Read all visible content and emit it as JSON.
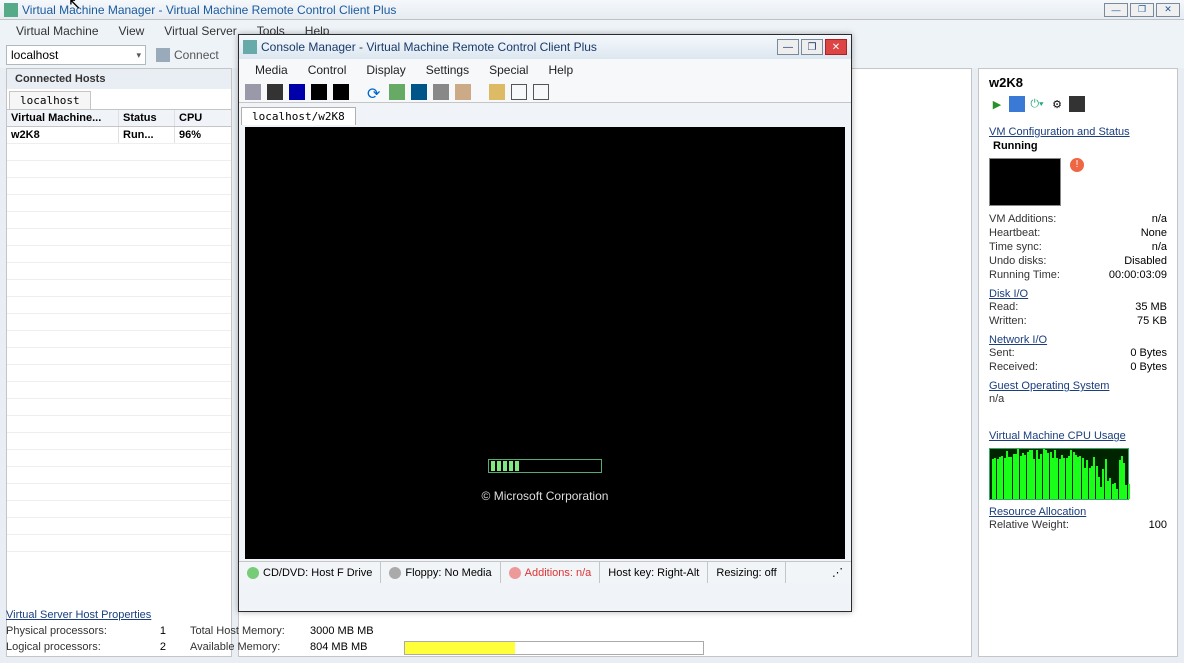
{
  "main": {
    "title": "Virtual Machine Manager - Virtual Machine Remote Control Client Plus",
    "menu": [
      "Virtual Machine",
      "View",
      "Virtual Server",
      "Tools",
      "Help"
    ],
    "host_selected": "localhost",
    "connect_label": "Connect"
  },
  "left": {
    "header": "Connected Hosts",
    "tab": "localhost",
    "columns": [
      "Virtual Machine...",
      "Status",
      "CPU"
    ],
    "rows": [
      {
        "name": "w2K8",
        "status": "Run...",
        "cpu": "96%"
      }
    ]
  },
  "bottom": {
    "heading": "Virtual Server Host Properties",
    "physical_k": "Physical processors:",
    "physical_v": "1",
    "logical_k": "Logical processors:",
    "logical_v": "2",
    "total_mem_k": "Total Host Memory:",
    "total_mem_v": "3000 MB MB",
    "avail_mem_k": "Available Memory:",
    "avail_mem_v": "804 MB MB",
    "mem_pct": 37
  },
  "console": {
    "title": "Console Manager - Virtual Machine Remote Control Client Plus",
    "menu": [
      "Media",
      "Control",
      "Display",
      "Settings",
      "Special",
      "Help"
    ],
    "tab": "localhost/w2K8",
    "boot_text": "© Microsoft Corporation",
    "status": {
      "cd": "CD/DVD: Host F Drive",
      "floppy": "Floppy: No Media",
      "additions": "Additions: n/a",
      "hostkey": "Host key: Right-Alt",
      "resizing": "Resizing: off"
    }
  },
  "right": {
    "vm_name": "w2K8",
    "sect_config": "VM Configuration and Status",
    "status": "Running",
    "props": [
      {
        "k": "VM Additions:",
        "v": "n/a"
      },
      {
        "k": "Heartbeat:",
        "v": "None"
      },
      {
        "k": "Time sync:",
        "v": "n/a"
      },
      {
        "k": "Undo disks:",
        "v": "Disabled"
      },
      {
        "k": "Running Time:",
        "v": "00:00:03:09"
      }
    ],
    "sect_diskio": "Disk I/O",
    "diskio": [
      {
        "k": "Read:",
        "v": "35 MB"
      },
      {
        "k": "Written:",
        "v": "75 KB"
      }
    ],
    "sect_netio": "Network I/O",
    "netio": [
      {
        "k": "Sent:",
        "v": "0 Bytes"
      },
      {
        "k": "Received:",
        "v": "0 Bytes"
      }
    ],
    "sect_guest": "Guest Operating System",
    "guest_v": "n/a",
    "sect_cpu": "Virtual Machine CPU Usage",
    "sect_res": "Resource Allocation",
    "relweight_k": "Relative Weight:",
    "relweight_v": "100"
  }
}
